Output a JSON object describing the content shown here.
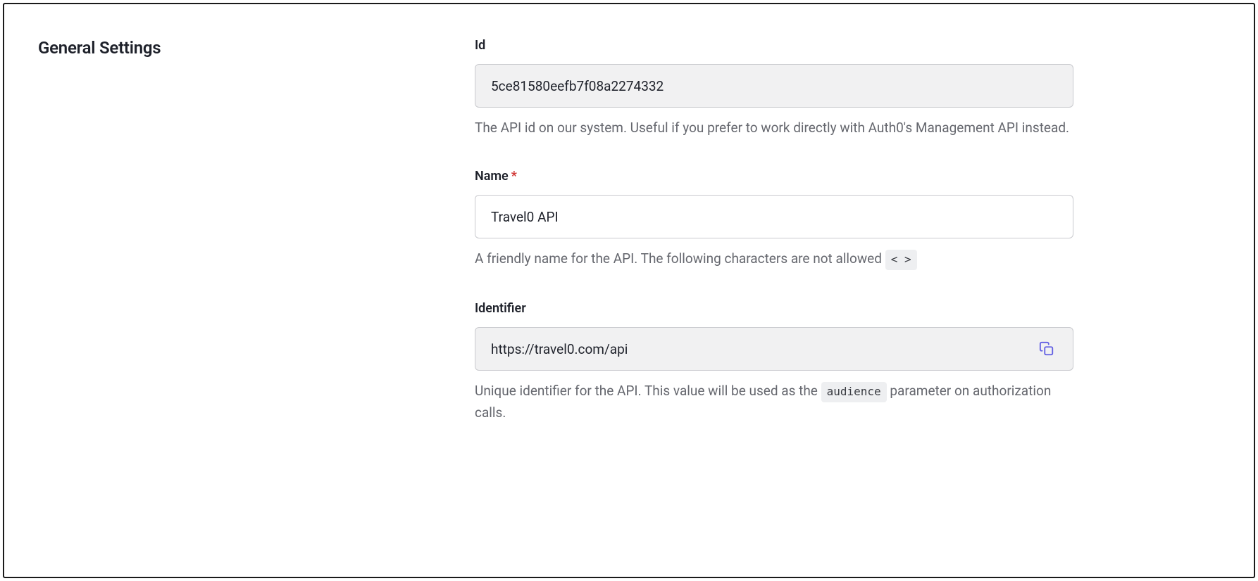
{
  "section": {
    "title": "General Settings"
  },
  "fields": {
    "id": {
      "label": "Id",
      "value": "5ce81580eefb7f08a2274332",
      "help": "The API id on our system. Useful if you prefer to work directly with Auth0's Management API instead."
    },
    "name": {
      "label": "Name",
      "required_mark": "*",
      "value": "Travel0 API",
      "help_prefix": "A friendly name for the API. The following characters are not allowed ",
      "chip": "< >"
    },
    "identifier": {
      "label": "Identifier",
      "value": "https://travel0.com/api",
      "help_prefix": "Unique identifier for the API. This value will be used as the ",
      "chip": "audience",
      "help_suffix": " parameter on authorization calls."
    }
  }
}
